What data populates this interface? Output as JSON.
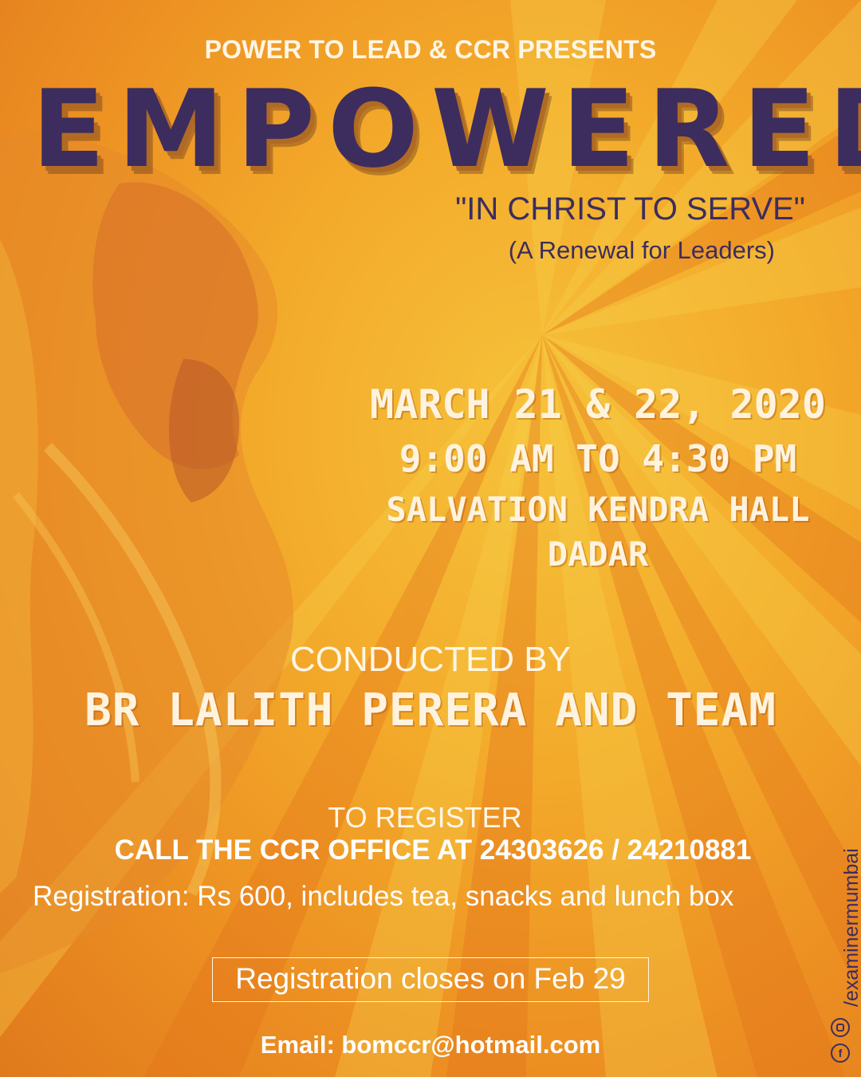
{
  "header": {
    "presents": "POWER TO LEAD & CCR PRESENTS",
    "title": "EMPOWERED",
    "subtitle": "\"IN CHRIST TO SERVE\"",
    "tagline": "(A Renewal for Leaders)"
  },
  "event": {
    "date": "MARCH 21 & 22, 2020",
    "time": "9:00 AM TO 4:30 PM",
    "venue": "SALVATION KENDRA HALL",
    "city": "DADAR"
  },
  "conducted": {
    "label": "CONDUCTED BY",
    "name": "BR LALITH PERERA AND TEAM"
  },
  "register": {
    "label": "TO REGISTER",
    "call": "CALL THE CCR OFFICE AT 24303626 / 24210881",
    "fee": "Registration: Rs 600, includes tea, snacks and lunch box",
    "closes": "Registration closes on Feb 29",
    "email": "Email: bomccr@hotmail.com"
  },
  "social": {
    "handle": "/examinermumbai",
    "icons": [
      "facebook-icon",
      "instagram-icon"
    ]
  },
  "colors": {
    "background": "#f3a92a",
    "title": "#3c2d5e",
    "text": "#fff6e6"
  }
}
